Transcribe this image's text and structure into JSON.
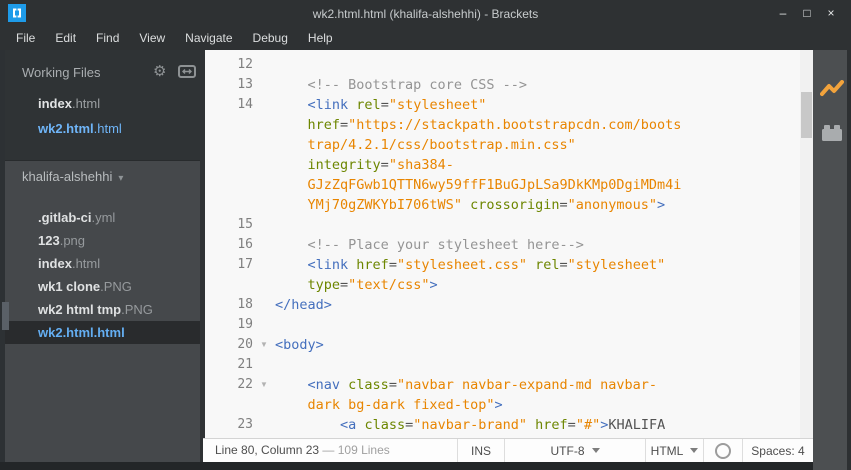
{
  "window": {
    "title": "wk2.html.html (khalifa-alshehhi) - Brackets",
    "controls": {
      "minimize": "–",
      "maximize": "□",
      "close": "×"
    }
  },
  "menu": {
    "items": [
      "File",
      "Edit",
      "Find",
      "View",
      "Navigate",
      "Debug",
      "Help"
    ]
  },
  "sidebar": {
    "working_files": {
      "header": "Working Files",
      "files": [
        {
          "base": "index",
          "ext": ".html",
          "active": false
        },
        {
          "base": "wk2.html",
          "ext": ".html",
          "active": true
        }
      ]
    },
    "project": {
      "name": "khalifa-alshehhi",
      "files": [
        {
          "base": ".gitlab-ci",
          "ext": ".yml",
          "selected": false
        },
        {
          "base": "123",
          "ext": ".png",
          "selected": false
        },
        {
          "base": "index",
          "ext": ".html",
          "selected": false
        },
        {
          "base": "wk1 clone",
          "ext": ".PNG",
          "selected": false
        },
        {
          "base": "wk2 html tmp",
          "ext": ".PNG",
          "selected": false
        },
        {
          "base": "wk2.html",
          "ext": ".html",
          "selected": true
        }
      ]
    }
  },
  "icons": {
    "gear": "⚙",
    "caret_down": "▾",
    "fold": "▼"
  },
  "editor": {
    "rows": [
      {
        "n": "12",
        "f": false,
        "s": []
      },
      {
        "n": "13",
        "f": false,
        "s": [
          [
            "    ",
            "txt"
          ],
          [
            "<!-- Bootstrap core CSS -->",
            "com"
          ]
        ]
      },
      {
        "n": "14",
        "f": false,
        "s": [
          [
            "    ",
            "txt"
          ],
          [
            "<link",
            "tag"
          ],
          [
            " ",
            "txt"
          ],
          [
            "rel",
            "attr"
          ],
          [
            "=",
            "txt"
          ],
          [
            "\"stylesheet\"",
            "str"
          ]
        ]
      },
      {
        "n": "",
        "f": false,
        "s": [
          [
            "    ",
            "txt"
          ],
          [
            "href",
            "attr"
          ],
          [
            "=",
            "txt"
          ],
          [
            "\"https://stackpath.bootstrapcdn.com/boots",
            "str"
          ]
        ]
      },
      {
        "n": "",
        "f": false,
        "s": [
          [
            "    ",
            "txt"
          ],
          [
            "trap/4.2.1/css/bootstrap.min.css\"",
            "str"
          ]
        ]
      },
      {
        "n": "",
        "f": false,
        "s": [
          [
            "    ",
            "txt"
          ],
          [
            "integrity",
            "attr"
          ],
          [
            "=",
            "txt"
          ],
          [
            "\"sha384-",
            "str"
          ]
        ]
      },
      {
        "n": "",
        "f": false,
        "s": [
          [
            "    ",
            "txt"
          ],
          [
            "GJzZqFGwb1QTTN6wy59ffF1BuGJpLSa9DkKMp0DgiMDm4i",
            "str"
          ]
        ]
      },
      {
        "n": "",
        "f": false,
        "s": [
          [
            "    ",
            "txt"
          ],
          [
            "YMj70gZWKYbI706tWS\"",
            "str"
          ],
          [
            " ",
            "txt"
          ],
          [
            "crossorigin",
            "attr"
          ],
          [
            "=",
            "txt"
          ],
          [
            "\"anonymous\"",
            "str"
          ],
          [
            ">",
            "tag"
          ]
        ]
      },
      {
        "n": "15",
        "f": false,
        "s": []
      },
      {
        "n": "16",
        "f": false,
        "s": [
          [
            "    ",
            "txt"
          ],
          [
            "<!-- Place your stylesheet here-->",
            "com"
          ]
        ]
      },
      {
        "n": "17",
        "f": false,
        "s": [
          [
            "    ",
            "txt"
          ],
          [
            "<link",
            "tag"
          ],
          [
            " ",
            "txt"
          ],
          [
            "href",
            "attr"
          ],
          [
            "=",
            "txt"
          ],
          [
            "\"stylesheet.css\"",
            "str"
          ],
          [
            " ",
            "txt"
          ],
          [
            "rel",
            "attr"
          ],
          [
            "=",
            "txt"
          ],
          [
            "\"stylesheet\"",
            "str"
          ]
        ]
      },
      {
        "n": "",
        "f": false,
        "s": [
          [
            "    ",
            "txt"
          ],
          [
            "type",
            "attr"
          ],
          [
            "=",
            "txt"
          ],
          [
            "\"text/css\"",
            "str"
          ],
          [
            ">",
            "tag"
          ]
        ]
      },
      {
        "n": "18",
        "f": false,
        "s": [
          [
            "</head>",
            "tag"
          ]
        ]
      },
      {
        "n": "19",
        "f": false,
        "s": []
      },
      {
        "n": "20",
        "f": true,
        "s": [
          [
            "<body>",
            "tag"
          ]
        ]
      },
      {
        "n": "21",
        "f": false,
        "s": []
      },
      {
        "n": "22",
        "f": true,
        "s": [
          [
            "    ",
            "txt"
          ],
          [
            "<nav",
            "tag"
          ],
          [
            " ",
            "txt"
          ],
          [
            "class",
            "attr"
          ],
          [
            "=",
            "txt"
          ],
          [
            "\"navbar navbar-expand-md navbar-",
            "str"
          ]
        ]
      },
      {
        "n": "",
        "f": false,
        "s": [
          [
            "    ",
            "txt"
          ],
          [
            "dark bg-dark fixed-top\"",
            "str"
          ],
          [
            ">",
            "tag"
          ]
        ]
      },
      {
        "n": "23",
        "f": false,
        "s": [
          [
            "        ",
            "txt"
          ],
          [
            "<a",
            "tag"
          ],
          [
            " ",
            "txt"
          ],
          [
            "class",
            "attr"
          ],
          [
            "=",
            "txt"
          ],
          [
            "\"navbar-brand\"",
            "str"
          ],
          [
            " ",
            "txt"
          ],
          [
            "href",
            "attr"
          ],
          [
            "=",
            "txt"
          ],
          [
            "\"#\"",
            "str"
          ],
          [
            ">",
            "tag"
          ],
          [
            "KHALIFA",
            "txt"
          ]
        ]
      }
    ]
  },
  "statusbar": {
    "position": "Line 80, Column 23 ",
    "total_lines": "— 109 Lines",
    "insert_mode": "INS",
    "encoding": "UTF-8",
    "language": "HTML",
    "spaces_label": "Spaces:",
    "spaces_value": "4"
  },
  "colors": {
    "accent_file_blue": "#6fb5f8",
    "syntax_tag": "#446fbd",
    "syntax_attribute": "#6d8600",
    "syntax_string": "#e88501",
    "syntax_comment": "#949494",
    "syntax_text": "#535353",
    "editor_bg": "#f8f8f8",
    "chrome_bg": "#2e3133",
    "live_preview_orange": "#f2a33c"
  }
}
